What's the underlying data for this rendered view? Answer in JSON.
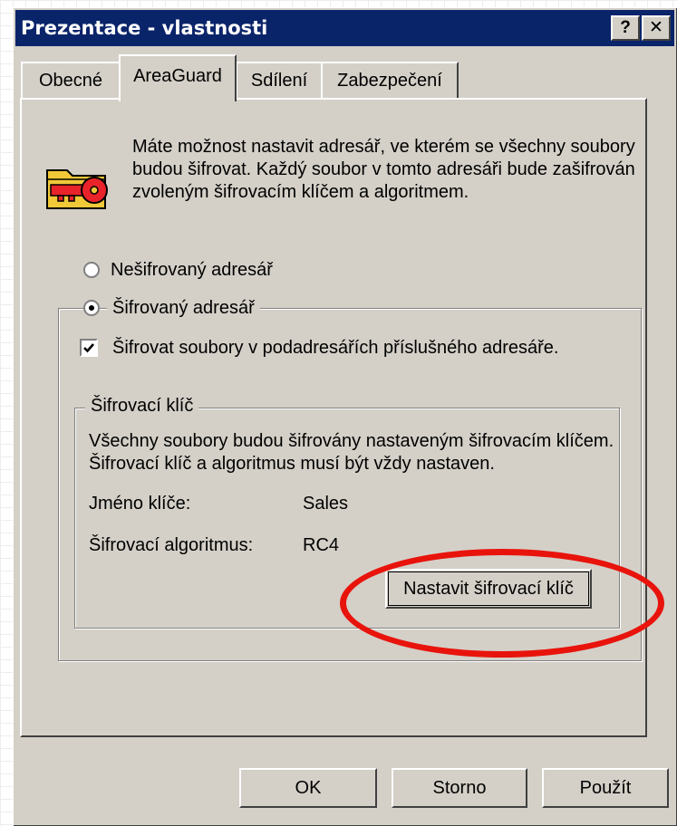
{
  "window": {
    "title": "Prezentace - vlastnosti",
    "help_label": "?",
    "close_label": "✕"
  },
  "tabs": [
    {
      "label": "Obecné",
      "active": false
    },
    {
      "label": "AreaGuard",
      "active": true
    },
    {
      "label": "Sdílení",
      "active": false
    },
    {
      "label": "Zabezpečení",
      "active": false
    }
  ],
  "areaguard": {
    "description": "Máte možnost nastavit adresář, ve kterém se všechny soubory budou šifrovat. Každý soubor v tomto adresáři bude zašifrován zvoleným šifrovacím klíčem a algoritmem.",
    "radio_unencrypted": "Nešifrovaný adresář",
    "radio_encrypted": "Šifrovaný adresář",
    "selected_radio": "encrypted",
    "subdirs_checkbox": "Šifrovat soubory v podadresářích příslušného adresáře.",
    "subdirs_checked": true,
    "key_group": {
      "title": "Šifrovací klíč",
      "description": "Všechny soubory budou šifrovány nastaveným šifrovacím klíčem. Šifrovací klíč a algoritmus musí být vždy nastaven.",
      "key_name_label": "Jméno klíče:",
      "key_name_value": "Sales",
      "algorithm_label": "Šifrovací algoritmus:",
      "algorithm_value": "RC4",
      "set_key_button": "Nastavit šifrovací klíč"
    }
  },
  "footer": {
    "ok": "OK",
    "cancel": "Storno",
    "apply": "Použít"
  },
  "colors": {
    "titlebar": "#0a246a",
    "dialog": "#d4d0c8",
    "highlight_ring": "#e8140c",
    "key_icon": "#e8232a",
    "folder_icon": "#f0c838"
  },
  "icons": {
    "dialog_icon": "folder-key-icon"
  }
}
